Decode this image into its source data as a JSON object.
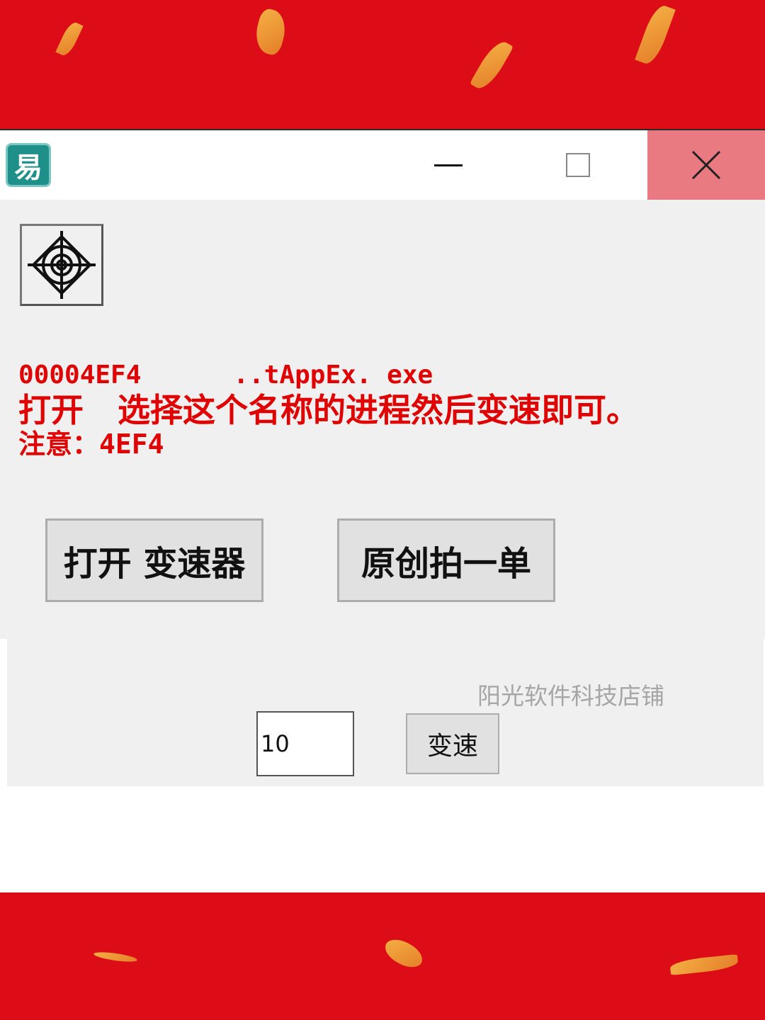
{
  "window": {
    "app_icon_glyph": "易",
    "close_hover_color": "#e97a82"
  },
  "info": {
    "line1": "00004EF4      ..tAppEx. exe",
    "line2": "打开   选择这个名称的进程然后变速即可。",
    "line3": "注意：4EF4"
  },
  "buttons": {
    "open_speeder": "打开  变速器",
    "original": "原创拍一单",
    "speed": "变速"
  },
  "shop_label": "阳光软件科技店铺",
  "speed_input": {
    "value": "10"
  },
  "colors": {
    "banner": "#dc0d16",
    "text_red": "#e00000"
  }
}
